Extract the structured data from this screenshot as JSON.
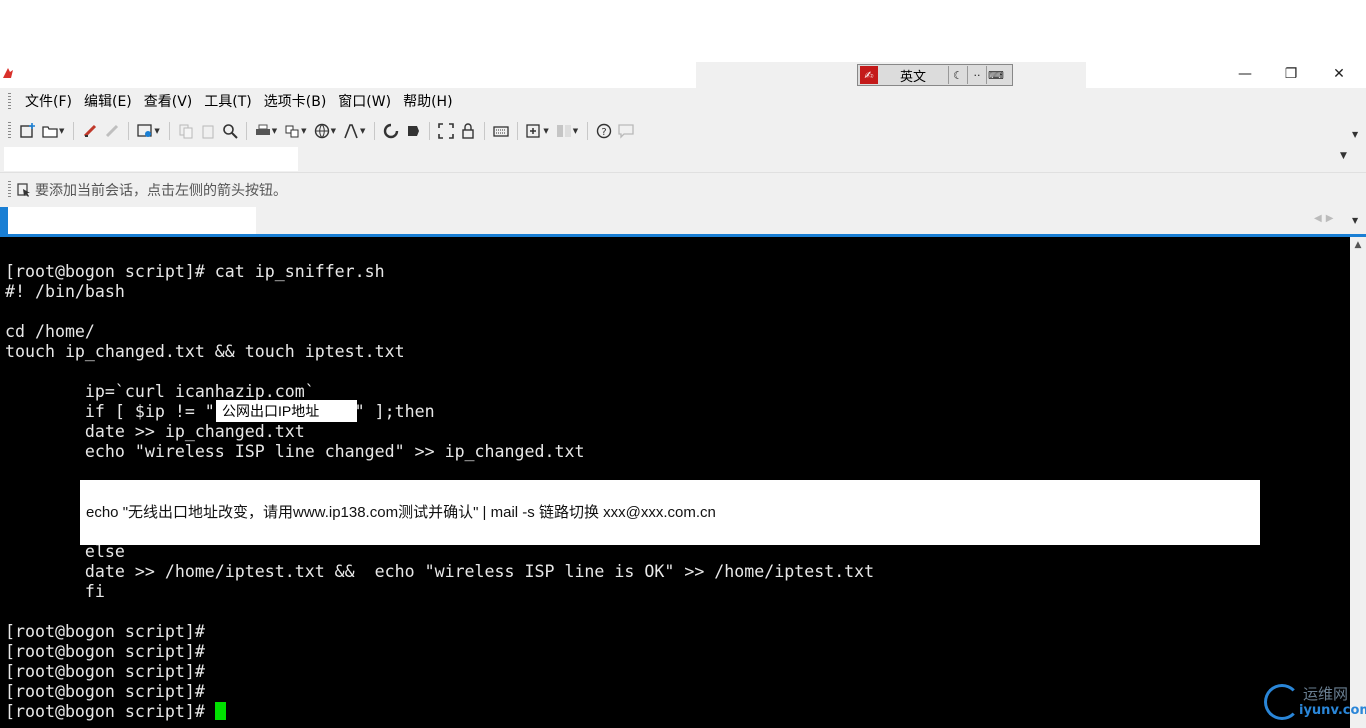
{
  "menubar": {
    "items": [
      {
        "label": "文件(F)"
      },
      {
        "label": "编辑(E)"
      },
      {
        "label": "查看(V)"
      },
      {
        "label": "工具(T)"
      },
      {
        "label": "选项卡(B)"
      },
      {
        "label": "窗口(W)"
      },
      {
        "label": "帮助(H)"
      }
    ]
  },
  "ime": {
    "mode": "英文",
    "logo_icon": "ime-logo-icon",
    "moon_icon": "moon-icon",
    "punct_icon": "punctuation-icon",
    "keyboard_icon": "keyboard-icon"
  },
  "window_controls": {
    "minimize": "—",
    "restore": "❐",
    "close": "✕"
  },
  "toolbar": {
    "icons": [
      "new-session-icon",
      "open-folder-icon",
      "connect-icon",
      "disconnect-icon",
      "properties-icon",
      "copy-icon",
      "paste-icon",
      "find-icon",
      "print-icon",
      "transfer-icon",
      "globe-icon",
      "font-icon",
      "script-icon",
      "script-record-icon",
      "fullscreen-icon",
      "lock-icon",
      "keyboard-icon",
      "new-tab-icon",
      "layout-icon",
      "help-icon",
      "chat-icon"
    ]
  },
  "address_bar": {
    "value": "",
    "dropdown_icon": "chevron-down-icon"
  },
  "session_hint": {
    "text": "要添加当前会话，点击左侧的箭头按钮。",
    "icon": "add-session-arrow-icon"
  },
  "tabs": [
    {
      "label": "",
      "active": true
    }
  ],
  "terminal": {
    "lines": [
      "[root@bogon script]# cat ip_sniffer.sh",
      "#! /bin/bash",
      "",
      "cd /home/",
      "touch ip_changed.txt && touch iptest.txt",
      "",
      "        ip=`curl icanhazip.com`",
      "        if [ $ip != \"              \" ];then",
      "        date >> ip_changed.txt",
      "        echo \"wireless ISP line changed\" >> ip_changed.txt",
      "",
      "",
      "",
      "",
      "        else",
      "        date >> /home/iptest.txt &&  echo \"wireless ISP line is OK\" >> /home/iptest.txt",
      "        fi",
      "",
      "[root@bogon script]#",
      "[root@bogon script]#",
      "[root@bogon script]#",
      "[root@bogon script]#",
      "[root@bogon script]# "
    ],
    "cursor_color": "#00e000",
    "ip_overlay": "公网出口IP地址",
    "mail_overlay": "echo \"无线出口地址改变，请用www.ip138.com测试并确认\" | mail -s 链路切换 xxx@xxx.com.cn"
  },
  "watermark": {
    "name": "运维网",
    "url": "iyunv.com"
  },
  "colors": {
    "accent": "#1a7fd4",
    "terminal_bg": "#000000",
    "terminal_fg": "#e8e8e8",
    "chrome": "#f0f0f0"
  }
}
